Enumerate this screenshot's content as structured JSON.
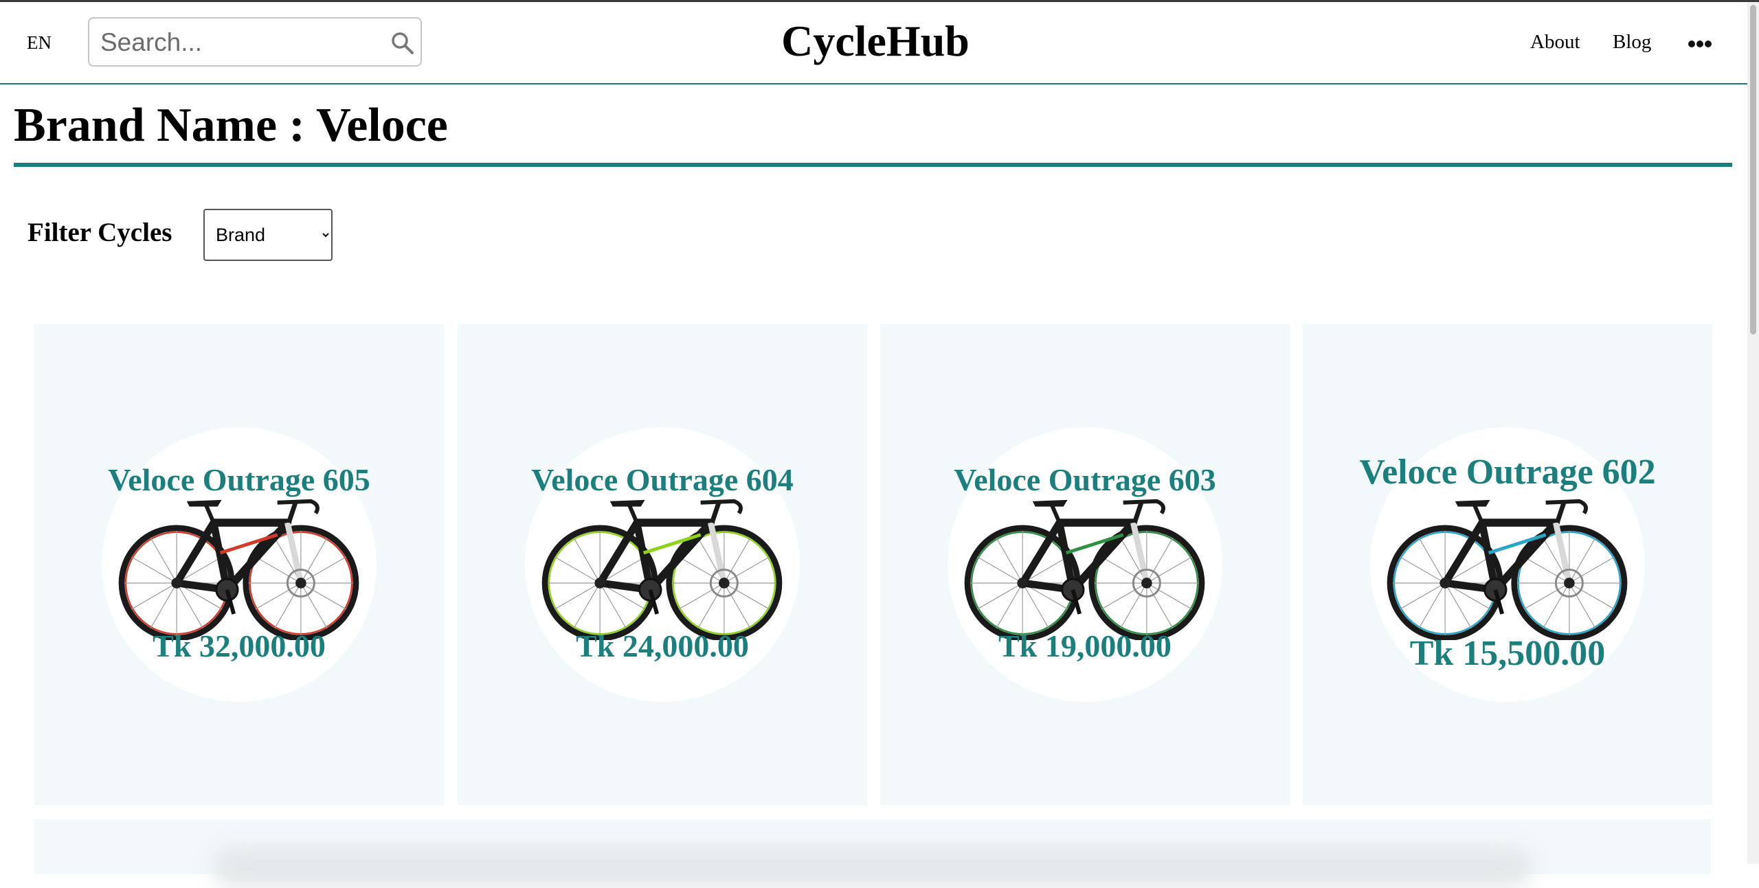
{
  "header": {
    "language": "EN",
    "search_placeholder": "Search...",
    "logo": "CycleHub",
    "nav": {
      "about": "About",
      "blog": "Blog"
    },
    "icons": {
      "search": "search-icon",
      "more": "more-horizontal-icon"
    }
  },
  "page": {
    "title": "Brand Name : Veloce"
  },
  "filter": {
    "label": "Filter Cycles",
    "selected": "Brand"
  },
  "colors": {
    "accent": "#1a7f7d",
    "card_bg": "#f3f8fa"
  },
  "products": [
    {
      "name": "Veloce Outrage 605",
      "price": "Tk 32,000.00",
      "frame_color": "#d43a2a",
      "image": "red-mountain-bike"
    },
    {
      "name": "Veloce Outrage 604",
      "price": "Tk 24,000.00",
      "frame_color": "#8fd21a",
      "image": "green-mountain-bike"
    },
    {
      "name": "Veloce Outrage 603",
      "price": "Tk 19,000.00",
      "frame_color": "#2f8f43",
      "image": "dark-green-mountain-bike"
    },
    {
      "name": "Veloce Outrage 602",
      "price": "Tk 15,500.00",
      "frame_color": "#2aa6c8",
      "image": "blue-mountain-bike"
    }
  ]
}
